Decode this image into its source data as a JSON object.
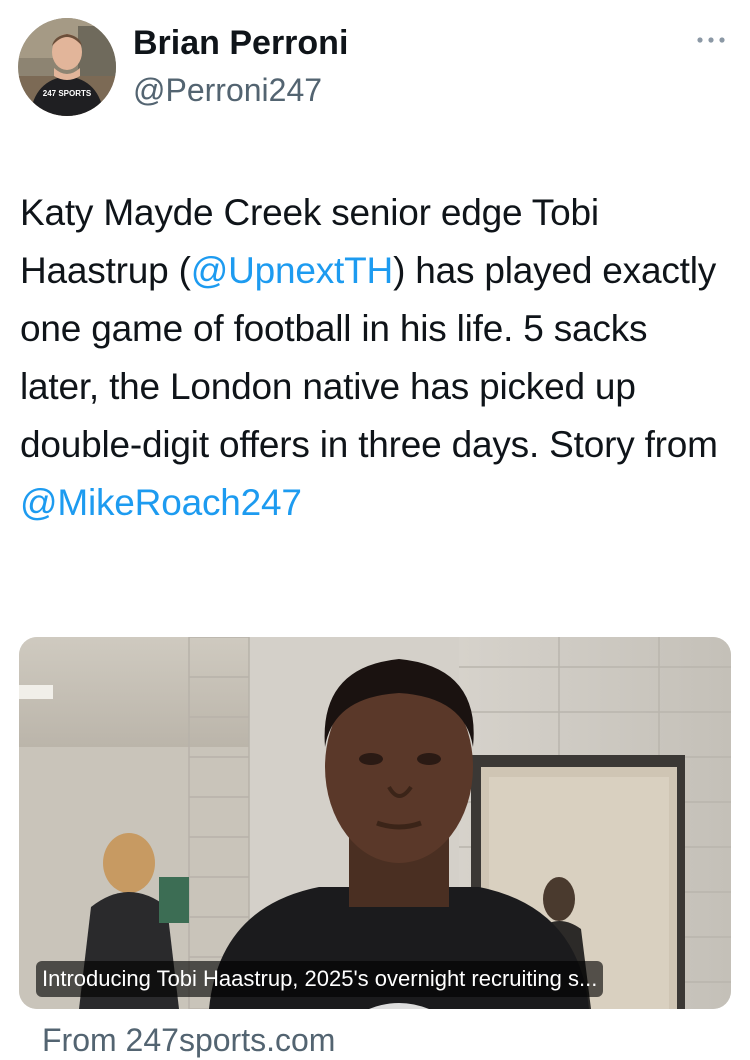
{
  "author": {
    "display_name": "Brian Perroni",
    "handle": "@Perroni247",
    "shirt_logo": "247 SPORTS",
    "avatar_icon": "avatar-photo"
  },
  "more_icon": "more-dots-icon",
  "tweet": {
    "segments": [
      {
        "text": "Katy Mayde Creek senior edge Tobi Haastrup (",
        "type": "text"
      },
      {
        "text": "@UpnextTH",
        "type": "mention"
      },
      {
        "text": ") has played exactly one game of football in his life. 5 sacks later, the London native has picked up double-digit offers in three days. Story from ",
        "type": "text"
      },
      {
        "text": "@MikeRoach247",
        "type": "mention"
      }
    ]
  },
  "card": {
    "caption": "Introducing Tobi Haastrup, 2025's overnight recruiting s...",
    "source": "From 247sports.com"
  },
  "colors": {
    "text": "#0f1419",
    "secondary": "#536471",
    "link": "#1d9bf0"
  }
}
